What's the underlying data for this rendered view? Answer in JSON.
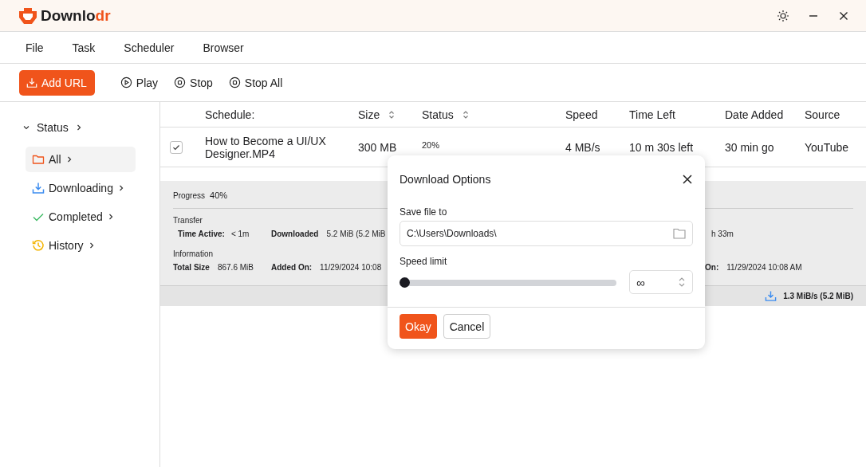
{
  "app": {
    "logo_main": "Downlo",
    "logo_accent": "dr"
  },
  "menu": [
    "File",
    "Task",
    "Scheduler",
    "Browser"
  ],
  "toolbar": {
    "primary": "Add URL",
    "actions": [
      {
        "kind": "play",
        "label": "Play"
      },
      {
        "kind": "stop",
        "label": "Stop"
      },
      {
        "kind": "stop",
        "label": "Stop All"
      }
    ]
  },
  "sidebar": {
    "label": "Status",
    "expanded": true,
    "items": [
      {
        "kind": "folder",
        "label": "All",
        "selected": true
      },
      {
        "kind": "download",
        "label": "Downloading",
        "selected": false
      },
      {
        "kind": "check",
        "label": "Completed",
        "selected": false
      },
      {
        "kind": "history",
        "label": "History",
        "selected": false
      }
    ]
  },
  "table": {
    "columns": [
      {
        "label": "Schedule:",
        "sortable": false
      },
      {
        "label": "Size",
        "sortable": true
      },
      {
        "label": "Status",
        "sortable": true
      },
      {
        "label": "Speed",
        "sortable": false
      },
      {
        "label": "Time Left",
        "sortable": false
      },
      {
        "label": "Date Added",
        "sortable": false
      },
      {
        "label": "Source",
        "sortable": false
      }
    ],
    "rows": [
      {
        "checked": true,
        "cells": [
          "How to Become a UI/UX Designer.MP4",
          "300 MB",
          "20%",
          "4 MB/s",
          "10 m 30s left",
          "30 min go",
          "YouTube"
        ]
      }
    ]
  },
  "details": {
    "progress_label": "Progress",
    "progress_value": "40%",
    "transfer_title": "Transfer",
    "time_active_label": "Time Active:",
    "time_active_value": "< 1m",
    "downloaded_label": "Downloaded",
    "downloaded_value": "5.2 MiB (5.2 MiB",
    "transfer_right": "h 33m",
    "info_title": "Information",
    "total_size_label": "Total Size",
    "total_size_value": "867.6 MiB",
    "added_label": "Added On:",
    "added_value": "11/29/2024 10:08",
    "info_right_label": "On:",
    "info_right_value": "11/29/2024 10:08 AM"
  },
  "status_bar": {
    "speed": "1.3 MiB/s (5.2 MiB)"
  },
  "dialog": {
    "title": "Download Options",
    "save_label": "Save file to",
    "save_path": "C:\\Users\\Downloads\\",
    "speed_label": "Speed limit",
    "speed_slider": {
      "level": 0
    },
    "speed_value": "∞",
    "ok": "Okay",
    "cancel": "Cancel"
  }
}
